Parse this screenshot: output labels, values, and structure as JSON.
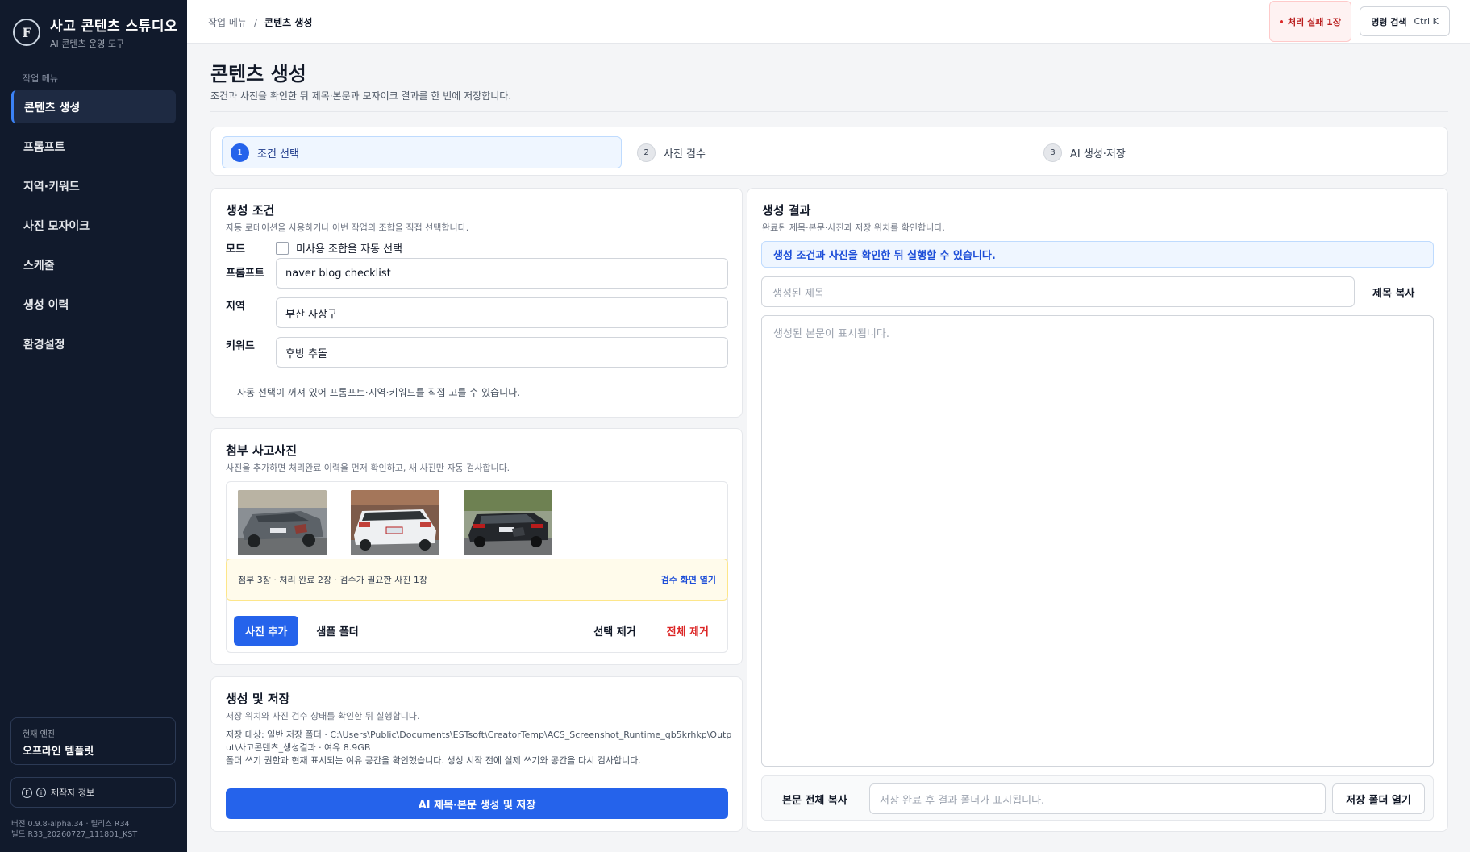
{
  "app": {
    "title": "사고 콘텐츠 스튜디오",
    "subtitle": "AI 콘텐츠 운영 도구",
    "logo_text": "F"
  },
  "sidebar": {
    "section_label": "작업 메뉴",
    "items": [
      {
        "label": "콘텐츠 생성",
        "active": true
      },
      {
        "label": "프롬프트",
        "active": false
      },
      {
        "label": "지역·키워드",
        "active": false
      },
      {
        "label": "사진 모자이크",
        "active": false
      },
      {
        "label": "스케줄",
        "active": false
      },
      {
        "label": "생성 이력",
        "active": false
      },
      {
        "label": "환경설정",
        "active": false
      }
    ],
    "engine_label": "현재 엔진",
    "engine_value": "오프라인 템플릿",
    "maker_label": "제작자 정보",
    "version_line1": "버전 0.9.8-alpha.34 · 릴리스 R34",
    "version_line2": "빌드 R33_20260727_111801_KST"
  },
  "topbar": {
    "crumb_root": "작업 메뉴",
    "crumb_sep": "/",
    "crumb_current": "콘텐츠 생성",
    "fail_badge": "처리 실패 1장",
    "command_label": "명령 검색",
    "command_shortcut": "Ctrl K"
  },
  "page": {
    "title": "콘텐츠 생성",
    "description": "조건과 사진을 확인한 뒤 제목·본문과 모자이크 결과를 한 번에 저장합니다."
  },
  "stepper": {
    "steps": [
      {
        "num": "1",
        "label": "조건 선택"
      },
      {
        "num": "2",
        "label": "사진 검수"
      },
      {
        "num": "3",
        "label": "AI 생성·저장"
      }
    ]
  },
  "conditions": {
    "title": "생성 조건",
    "subtitle": "자동 로테이션을 사용하거나 이번 작업의 조합을 직접 선택합니다.",
    "mode_label": "모드",
    "mode_checkbox_label": "미사용 조합을 자동 선택",
    "prompt_label": "프롬프트",
    "prompt_value": "naver blog checklist",
    "region_label": "지역",
    "region_value": "부산 사상구",
    "keyword_label": "키워드",
    "keyword_value": "후방 추돌",
    "hint": "자동 선택이 꺼져 있어 프롬프트·지역·키워드를 직접 고를 수 있습니다."
  },
  "photos": {
    "title": "첨부 사고사진",
    "subtitle": "사진을 추가하면 처리완료 이력을 먼저 확인하고, 새 사진만 자동 검사합니다.",
    "notice": "첨부 3장 · 처리 완료 2장 · 검수가 필요한 사진 1장",
    "review_link": "검수 화면 열기",
    "add_button": "사진 추가",
    "sample_button": "샘플 폴더",
    "remove_selected_button": "선택 제거",
    "remove_all_button": "전체 제거"
  },
  "save": {
    "title": "생성 및 저장",
    "subtitle": "저장 위치와 사진 검수 상태를 확인한 뒤 실행합니다.",
    "target": "저장 대상: 일반 저장 폴더 · C:\\Users\\Public\\Documents\\ESTsoft\\CreatorTemp\\ACS_Screenshot_Runtime_qb5krhkp\\Output\\사고콘텐츠_생성결과 · 여유 8.9GB",
    "permission_note": "폴더 쓰기 권한과 현재 표시되는 여유 공간을 확인했습니다. 생성 시작 전에 실제 쓰기와 공간을 다시 검사합니다.",
    "button": "AI 제목·본문 생성 및 저장"
  },
  "result": {
    "title": "생성 결과",
    "subtitle": "완료된 제목·본문·사진과 저장 위치를 확인합니다.",
    "notice": "생성 조건과 사진을 확인한 뒤 실행할 수 있습니다.",
    "title_placeholder": "생성된 제목",
    "copy_title_button": "제목 복사",
    "body_placeholder": "생성된 본문이 표시됩니다.",
    "copy_body_button": "본문 전체 복사",
    "path_placeholder": "저장 완료 후 결과 폴더가 표시됩니다.",
    "open_folder_button": "저장 폴더 열기"
  },
  "colors": {
    "sidebar_bg": "#111a2c",
    "accent": "#2563eb",
    "danger": "#dc2626",
    "warning_bg": "#fffbeb"
  }
}
